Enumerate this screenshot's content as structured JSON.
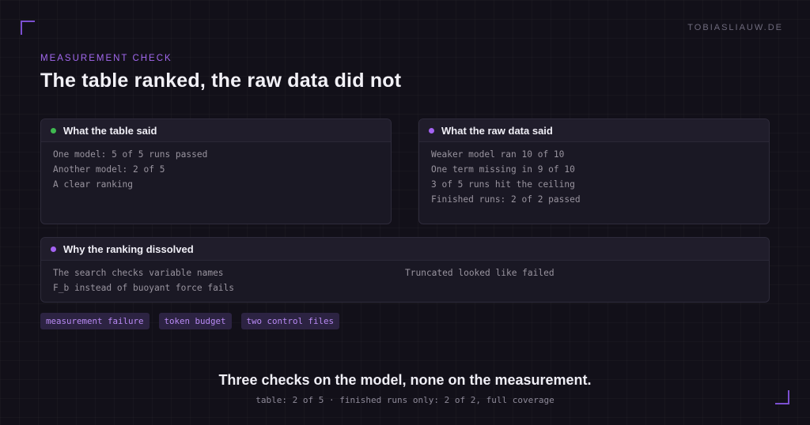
{
  "site": "TOBIASLIAUW.DE",
  "eyebrow": "MEASUREMENT CHECK",
  "title": "The table ranked, the raw data did not",
  "colors": {
    "background": "#121019",
    "accent": "#a463f2",
    "green_dot": "#3fb950",
    "purple_dot": "#a463f2"
  },
  "cards": {
    "table": {
      "heading": "What the table said",
      "lines": [
        "One model: 5 of 5 runs passed",
        "Another model: 2 of 5",
        "A clear ranking"
      ]
    },
    "raw": {
      "heading": "What the raw data said",
      "lines": [
        "Weaker model ran 10 of 10",
        "One term missing in 9 of 10",
        "3 of 5 runs hit the ceiling",
        "Finished runs: 2 of 2 passed"
      ]
    },
    "why": {
      "heading": "Why the ranking dissolved",
      "left_lines": [
        "The search checks variable names",
        "F_b instead of buoyant force fails"
      ],
      "right_lines": [
        "Truncated looked like failed"
      ]
    }
  },
  "tags": [
    "measurement failure",
    "token budget",
    "two control files"
  ],
  "footer": {
    "headline": "Three checks on the model, none on the measurement.",
    "subline": "table: 2 of 5 · finished runs only: 2 of 2, full coverage"
  }
}
